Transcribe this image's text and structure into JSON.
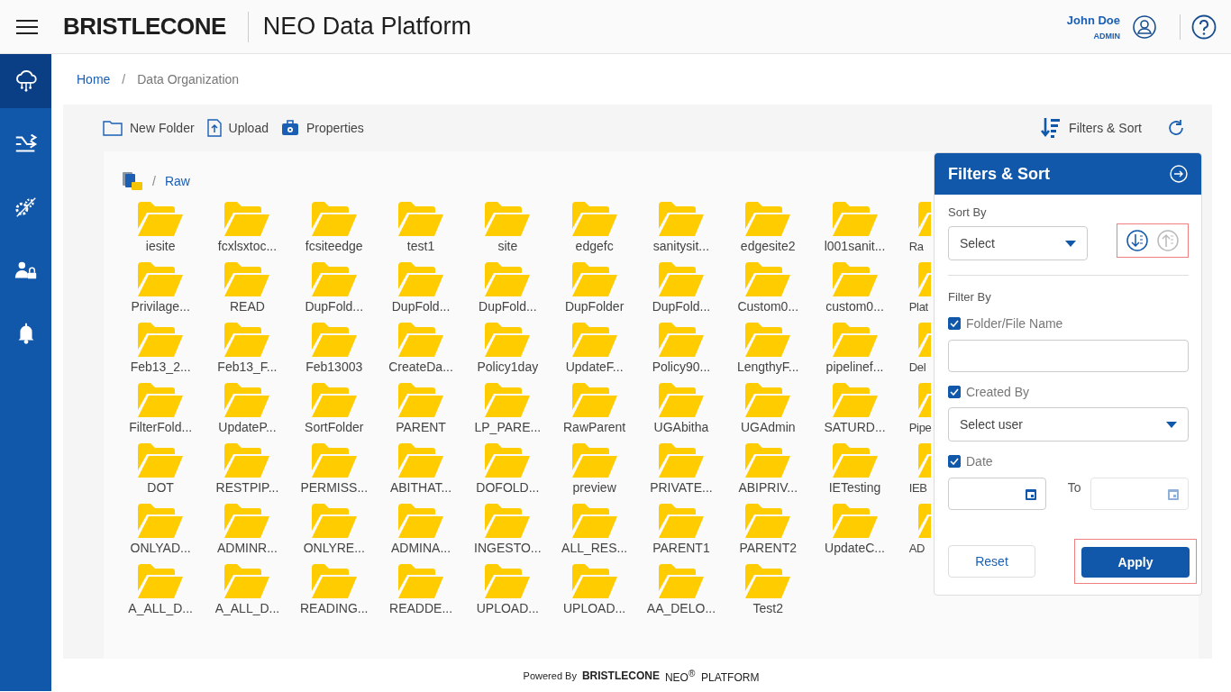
{
  "header": {
    "logo": "BRISTLECONE",
    "title": "NEO Data Platform",
    "user": {
      "name": "John Doe",
      "role": "ADMIN"
    }
  },
  "sidebar": {
    "items": [
      {
        "selected": true
      },
      {
        "selected": false
      },
      {
        "selected": false
      },
      {
        "selected": false
      },
      {
        "selected": false
      }
    ]
  },
  "breadcrumb": {
    "separator": "/",
    "items": [
      "Home",
      "Data Organization"
    ]
  },
  "toolbar": {
    "actions": [
      {
        "label": "New Folder"
      },
      {
        "label": "Upload"
      },
      {
        "label": "Properties"
      }
    ],
    "filters_label": "Filters & Sort"
  },
  "path": {
    "separator": "/",
    "items": [
      "Raw"
    ]
  },
  "folders": [
    {
      "name": "iesite",
      "kind": "full"
    },
    {
      "name": "fcxlsxtoc...",
      "kind": "full"
    },
    {
      "name": "fcsiteedge",
      "kind": "full"
    },
    {
      "name": "test1",
      "kind": "full"
    },
    {
      "name": "site",
      "kind": "full"
    },
    {
      "name": "edgefc",
      "kind": "full"
    },
    {
      "name": "sanitysit...",
      "kind": "full"
    },
    {
      "name": "edgesite2",
      "kind": "full"
    },
    {
      "name": "l001sanit...",
      "kind": "full"
    },
    {
      "name": "Ra",
      "kind": "cut"
    },
    {
      "name": "Privilage...",
      "kind": "full"
    },
    {
      "name": "READ",
      "kind": "full"
    },
    {
      "name": "DupFold...",
      "kind": "full"
    },
    {
      "name": "DupFold...",
      "kind": "full"
    },
    {
      "name": "DupFold...",
      "kind": "full"
    },
    {
      "name": "DupFolder",
      "kind": "full"
    },
    {
      "name": "DupFold...",
      "kind": "full"
    },
    {
      "name": "Custom0...",
      "kind": "full"
    },
    {
      "name": "custom0...",
      "kind": "full"
    },
    {
      "name": "Plat",
      "kind": "cut"
    },
    {
      "name": "Feb13_2...",
      "kind": "full"
    },
    {
      "name": "Feb13_F...",
      "kind": "full"
    },
    {
      "name": "Feb13003",
      "kind": "full"
    },
    {
      "name": "CreateDa...",
      "kind": "full"
    },
    {
      "name": "Policy1day",
      "kind": "full"
    },
    {
      "name": "UpdateF...",
      "kind": "full"
    },
    {
      "name": "Policy90...",
      "kind": "full"
    },
    {
      "name": "LengthyF...",
      "kind": "full"
    },
    {
      "name": "pipelinef...",
      "kind": "full"
    },
    {
      "name": "Del",
      "kind": "cut"
    },
    {
      "name": "FilterFold...",
      "kind": "full"
    },
    {
      "name": "UpdateP...",
      "kind": "full"
    },
    {
      "name": "SortFolder",
      "kind": "full"
    },
    {
      "name": "PARENT",
      "kind": "full"
    },
    {
      "name": "LP_PARE...",
      "kind": "full"
    },
    {
      "name": "RawParent",
      "kind": "full"
    },
    {
      "name": "UGAbitha",
      "kind": "full"
    },
    {
      "name": "UGAdmin",
      "kind": "full"
    },
    {
      "name": "SATURD...",
      "kind": "full"
    },
    {
      "name": "Pipe",
      "kind": "cut"
    },
    {
      "name": "DOT",
      "kind": "full"
    },
    {
      "name": "RESTPIP...",
      "kind": "full"
    },
    {
      "name": "PERMISS...",
      "kind": "full"
    },
    {
      "name": "ABITHAT...",
      "kind": "full"
    },
    {
      "name": "DOFOLD...",
      "kind": "full"
    },
    {
      "name": "preview",
      "kind": "full"
    },
    {
      "name": "PRIVATE...",
      "kind": "full"
    },
    {
      "name": "ABIPRIV...",
      "kind": "full"
    },
    {
      "name": "IETesting",
      "kind": "full"
    },
    {
      "name": "IEB",
      "kind": "cut"
    },
    {
      "name": "ONLYAD...",
      "kind": "full"
    },
    {
      "name": "ADMINR...",
      "kind": "full"
    },
    {
      "name": "ONLYRE...",
      "kind": "full"
    },
    {
      "name": "ADMINA...",
      "kind": "full"
    },
    {
      "name": "INGESTO...",
      "kind": "full"
    },
    {
      "name": "ALL_RES...",
      "kind": "full"
    },
    {
      "name": "PARENT1",
      "kind": "full"
    },
    {
      "name": "PARENT2",
      "kind": "full"
    },
    {
      "name": "UpdateC...",
      "kind": "full"
    },
    {
      "name": "AD",
      "kind": "cut"
    },
    {
      "name": "A_ALL_D...",
      "kind": "full"
    },
    {
      "name": "A_ALL_D...",
      "kind": "full"
    },
    {
      "name": "READING...",
      "kind": "full"
    },
    {
      "name": "READDE...",
      "kind": "full"
    },
    {
      "name": "UPLOAD...",
      "kind": "full"
    },
    {
      "name": "UPLOAD...",
      "kind": "full"
    },
    {
      "name": "AA_DELO...",
      "kind": "full"
    },
    {
      "name": "Test2",
      "kind": "full"
    }
  ],
  "filter_panel": {
    "title": "Filters & Sort",
    "sort_label": "Sort By",
    "sort_select": "Select",
    "sort_directions": [
      {
        "kind": "down",
        "selected": true
      },
      {
        "kind": "up",
        "selected": false
      }
    ],
    "filter_label": "Filter By",
    "name_filter": {
      "label": "Folder/File Name",
      "checked": true
    },
    "created_filter": {
      "label": "Created By",
      "checked": true,
      "select": "Select user"
    },
    "date_filter": {
      "label": "Date",
      "checked": true,
      "to_label": "To"
    },
    "buttons": [
      "Reset",
      "Apply"
    ]
  },
  "footer": {
    "powered": "Powered By",
    "logo": "BRISTLECONE",
    "product": "NEO$^{®}$  PLATFORM"
  }
}
